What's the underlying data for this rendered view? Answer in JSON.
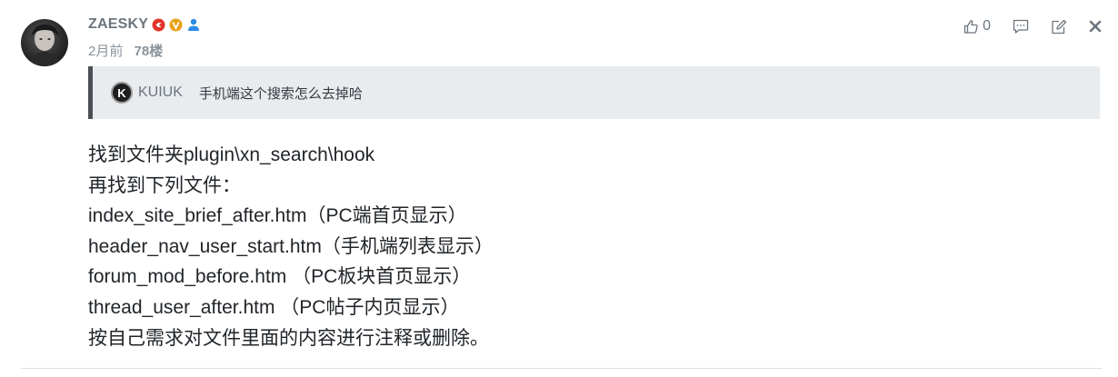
{
  "user": {
    "name": "ZAESKY",
    "time": "2月前",
    "floor": "78楼"
  },
  "actions": {
    "like_count": "0"
  },
  "quote": {
    "avatar_letter": "K",
    "user": "KUIUK",
    "text": "手机端这个搜索怎么去掉哈"
  },
  "content": {
    "lines": [
      "找到文件夹plugin\\xn_search\\hook",
      "再找到下列文件：",
      "index_site_brief_after.htm（PC端首页显示）",
      "header_nav_user_start.htm（手机端列表显示）",
      "forum_mod_before.htm （PC板块首页显示）",
      "thread_user_after.htm （PC帖子内页显示）",
      "按自己需求对文件里面的内容进行注释或删除。"
    ]
  },
  "colors": {
    "badge_red": "#e0352b",
    "badge_gold": "#e8a21a",
    "badge_blue": "#2b8be6",
    "quote_bg": "#e9ecef",
    "quote_border": "#4a5056"
  },
  "icons": [
    "admin-badge-icon",
    "vip-badge-icon",
    "user-icon",
    "thumbs-up-icon",
    "comment-icon",
    "edit-icon",
    "close-icon"
  ]
}
